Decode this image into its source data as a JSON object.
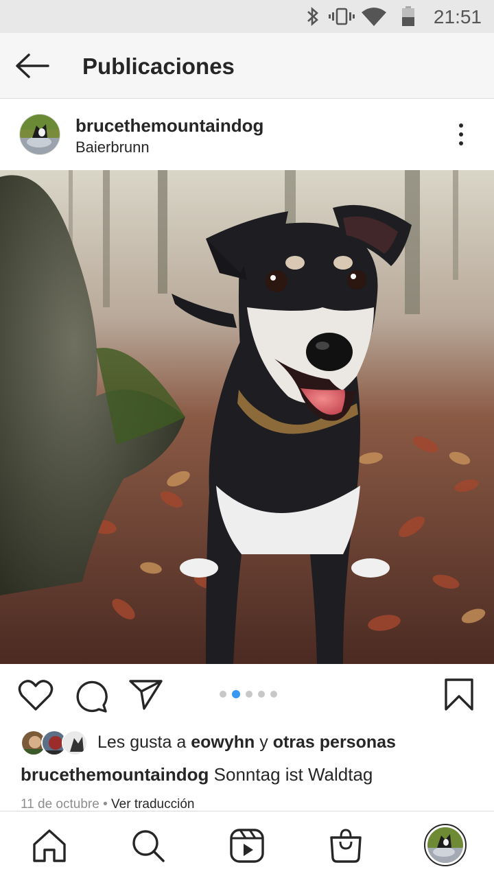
{
  "status_bar": {
    "time": "21:51"
  },
  "header": {
    "title": "Publicaciones"
  },
  "post": {
    "username": "brucethemountaindog",
    "location": "Baierbrunn",
    "carousel": {
      "count": 5,
      "active_index": 1
    },
    "likes": {
      "prefix": "Les gusta a ",
      "user": "eowyhn",
      "connector": " y ",
      "others": "otras personas"
    },
    "caption": {
      "username": "brucethemountaindog",
      "text": " Sonntag ist Waldtag"
    },
    "date": "11 de octubre",
    "separator": " • ",
    "translate_label": "Ver traducción"
  },
  "colors": {
    "accent": "#3897f0",
    "text": "#262626",
    "muted": "#8e8e8e"
  },
  "icons": [
    "bluetooth-icon",
    "vibrate-icon",
    "wifi-icon",
    "battery-icon",
    "back-arrow-icon",
    "more-vertical-icon",
    "heart-icon",
    "comment-icon",
    "send-icon",
    "bookmark-icon",
    "home-icon",
    "search-icon",
    "reels-icon",
    "shop-icon"
  ]
}
